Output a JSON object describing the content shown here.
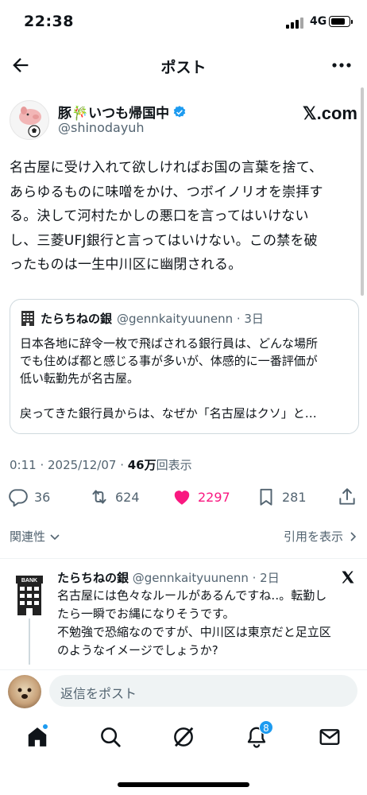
{
  "status_bar": {
    "time": "22:38",
    "network": "4G"
  },
  "nav": {
    "title": "ポスト"
  },
  "author": {
    "name": "豚🎋いつも帰国中",
    "handle": "@shinodayuh",
    "source_logo": "𝕏.com"
  },
  "tweet": {
    "lines": [
      "名古屋に受け入れて欲しければお国の言葉を捨て、",
      "あらゆるものに味噌をかけ、つボイノリオを崇拝す",
      "る。決して河村たかしの悪口を言ってはいけない",
      "し、三菱UFJ銀行と言ってはいけない。この禁を破",
      "ったものは一生中川区に幽閉される。"
    ]
  },
  "quote": {
    "name": "たらちねの銀",
    "meta": "@gennkaityuunenn · 3日",
    "lines": [
      "日本各地に辞令一枚で飛ばされる銀行員は、どんな場所",
      "でも住めば都と感じる事が多いが、体感的に一番評価が",
      "低い転勤先が名古屋。",
      "",
      "戻ってきた銀行員からは、なぜか「名古屋はクソ」と…"
    ]
  },
  "meta": {
    "time": "0:11 · 2025/12/07 · ",
    "views": "46万",
    "views_label": "回表示"
  },
  "actions": {
    "replies": "36",
    "reposts": "624",
    "likes": "2297",
    "bookmarks": "281"
  },
  "related": {
    "label": "関連性",
    "quotes_link": "引用を表示"
  },
  "reply": {
    "name": "たらちねの銀",
    "meta": " @gennkaityuunenn · 2日",
    "lines": [
      "名古屋には色々なルールがあるんですね‥。転勤し",
      "たら一瞬でお縄になりそうです。",
      "不勉強で恐縮なのですが、中川区は東京だと足立区",
      "のようなイメージでしょうか?"
    ]
  },
  "reply_bar": {
    "placeholder": "返信をポスト"
  },
  "tabbar": {
    "notification_count": "8"
  },
  "colors": {
    "accent": "#1d9bf0",
    "like": "#f91880",
    "muted": "#536471",
    "text": "#0f1419"
  },
  "icons": [
    "back-arrow-icon",
    "more-icon",
    "verified-icon",
    "x-logo-icon",
    "bank-icon",
    "reply-icon",
    "repost-icon",
    "heart-icon",
    "bookmark-icon",
    "share-icon",
    "chevron-down-icon",
    "chevron-right-icon",
    "home-icon",
    "search-icon",
    "grok-icon",
    "bell-icon",
    "mail-icon"
  ]
}
